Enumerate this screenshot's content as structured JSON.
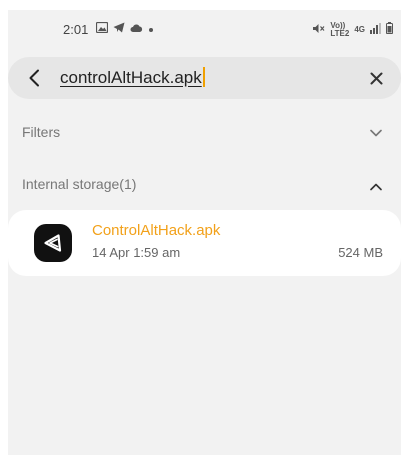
{
  "status_bar": {
    "time": "2:01",
    "network_labels": [
      "Vo))",
      "LTE2",
      "4G"
    ]
  },
  "search": {
    "query": "controlAltHack.apk"
  },
  "sections": {
    "filters_label": "Filters",
    "internal_storage_label": "Internal storage(1)"
  },
  "results": [
    {
      "name": "ControlAltHack.apk",
      "date": "14 Apr 1:59 am",
      "size": "524 MB",
      "icon": "apk-app-icon"
    }
  ],
  "colors": {
    "background": "#f2f2f2",
    "highlight": "#f2a11a",
    "card": "#ffffff"
  }
}
